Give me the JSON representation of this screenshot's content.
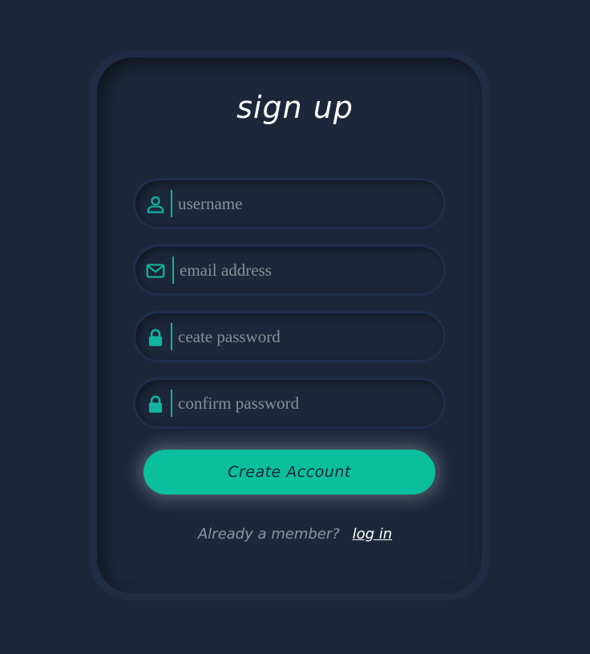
{
  "form": {
    "title": "sign up",
    "fields": [
      {
        "name": "username",
        "placeholder": "username",
        "icon": "user-icon",
        "value": ""
      },
      {
        "name": "email",
        "placeholder": "email address",
        "icon": "envelope-icon",
        "value": ""
      },
      {
        "name": "password",
        "placeholder": "ceate password",
        "icon": "lock-icon",
        "value": ""
      },
      {
        "name": "confirm",
        "placeholder": "confirm password",
        "icon": "lock-icon",
        "value": ""
      }
    ],
    "submit_label": "Create Account",
    "footer_text": "Already a member?",
    "login_link": "log in"
  },
  "colors": {
    "background": "#1c2739",
    "accent": "#0abf9e",
    "icon": "#12b3a0",
    "title": "#ffffff"
  }
}
